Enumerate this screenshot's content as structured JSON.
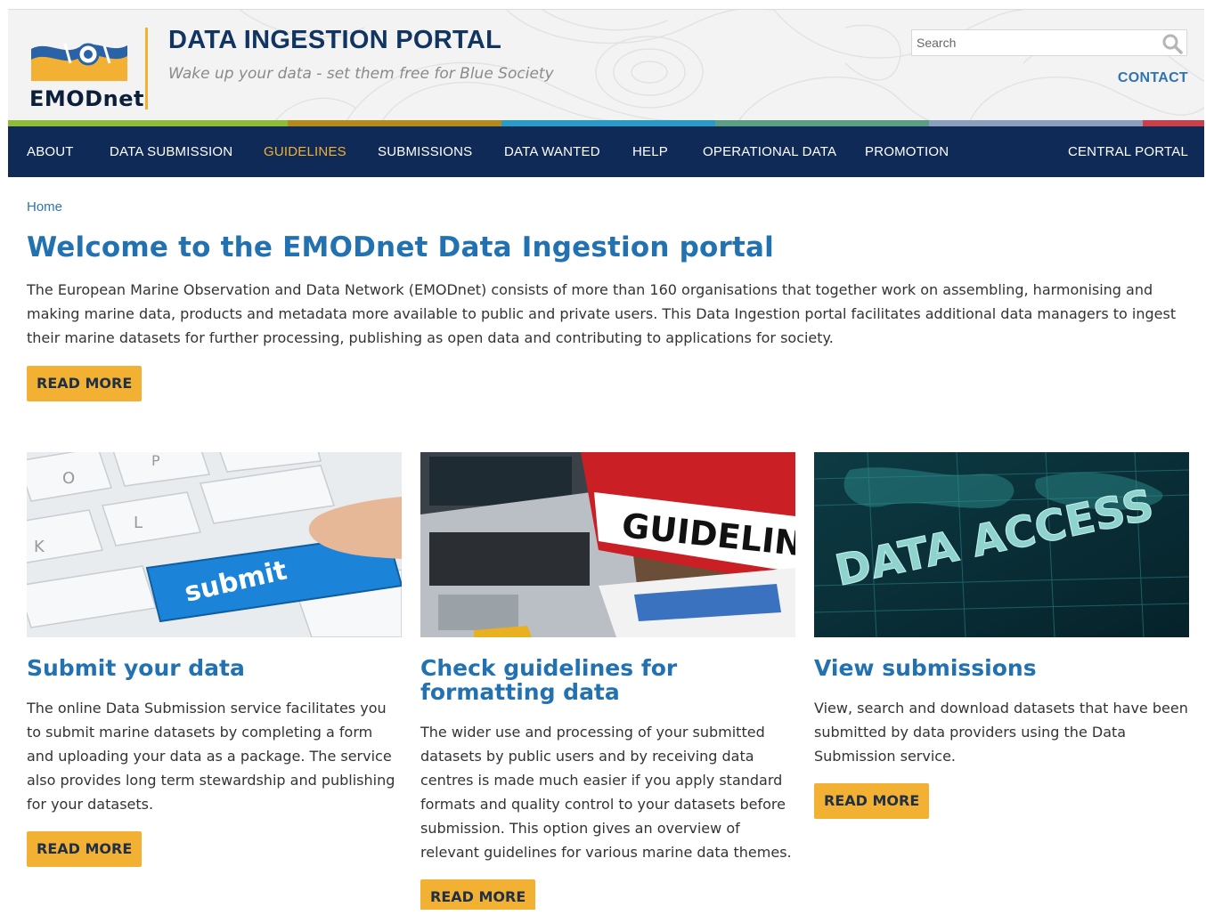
{
  "header": {
    "logo_text": "EMODnet",
    "site_title": "DATA INGESTION PORTAL",
    "slogan": "Wake up your data - set them free for Blue Society",
    "search_placeholder": "Search",
    "contact_label": "CONTACT"
  },
  "colors": {
    "nav_bg": "#0f2a56",
    "accent": "#f2b132",
    "link": "#2f73b2",
    "title": "#2271b1",
    "strip": [
      "#8fba3a",
      "#b38a1c",
      "#2a9ac9",
      "#5c9e85",
      "#8ba0bd",
      "#c9404a"
    ]
  },
  "nav": {
    "items": [
      {
        "label": "ABOUT"
      },
      {
        "label": "DATA SUBMISSION"
      },
      {
        "label": "GUIDELINES",
        "active": true
      },
      {
        "label": "SUBMISSIONS"
      },
      {
        "label": "DATA WANTED"
      },
      {
        "label": "HELP"
      },
      {
        "label": "OPERATIONAL DATA"
      },
      {
        "label": "PROMOTION"
      }
    ],
    "right_label": "CENTRAL PORTAL"
  },
  "breadcrumb": "Home",
  "main": {
    "title": "Welcome to the EMODnet Data Ingestion portal",
    "intro": "The European Marine Observation and Data Network (EMODnet) consists of more than 160 organisations that together work on assembling, harmonising and making marine data, products and metadata more available to public and private users. This Data Ingestion portal facilitates additional data managers to ingest their marine datasets for further processing, publishing as open data and contributing to applications for society.",
    "read_more": "READ MORE"
  },
  "cards": [
    {
      "image_text": "submit",
      "title": "Submit your data",
      "text": "The online Data Submission service facilitates you to submit marine datasets by completing a form and uploading your data as a package. The service also provides long term stewardship and publishing for your datasets.",
      "button": "READ MORE"
    },
    {
      "image_text": "GUIDELIN",
      "title": "Check guidelines for formatting data",
      "text": "The wider use and processing of your submitted datasets by public users and by receiving data centres is made much easier if you apply standard formats and quality control to your datasets before submission. This option gives an overview of relevant guidelines for various marine data themes.",
      "button": "READ MORE"
    },
    {
      "image_text": "DATA ACCESS",
      "title": "View submissions",
      "text": "View, search and download datasets that have been submitted by data providers using the Data Submission service.",
      "button": "READ MORE"
    }
  ]
}
